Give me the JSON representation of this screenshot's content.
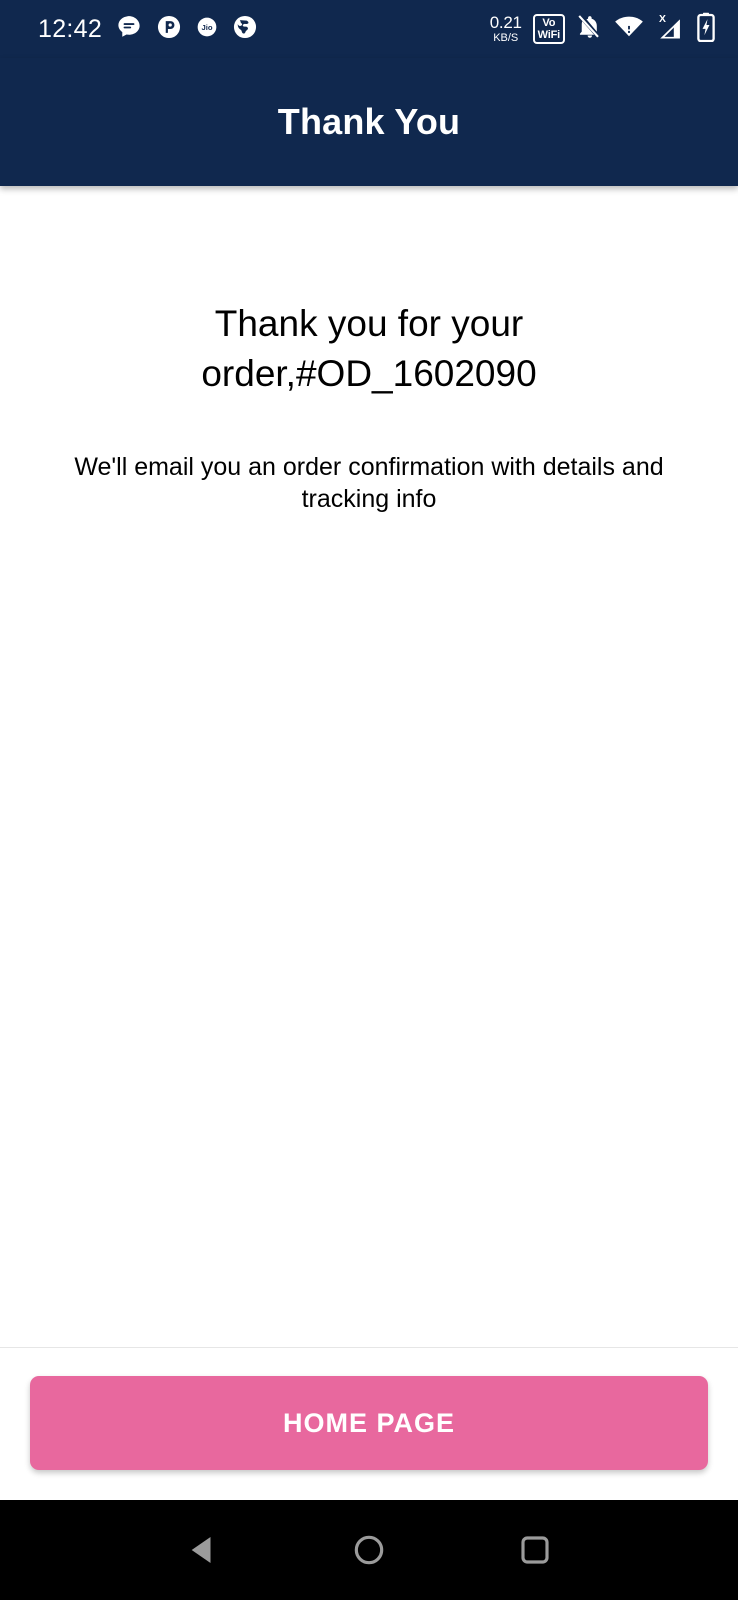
{
  "status_bar": {
    "clock": "12:42",
    "notification_icons": [
      {
        "name": "messages-icon",
        "label": "Messages"
      },
      {
        "name": "app-circle-icon",
        "label": "App"
      },
      {
        "name": "jio-icon",
        "label": "Jio"
      },
      {
        "name": "globe-icon",
        "label": "Browser"
      }
    ],
    "network_speed_value": "0.21",
    "network_speed_unit": "KB/S",
    "vowifi_line1": "Vo",
    "vowifi_line2": "WiFi",
    "system_icons": [
      {
        "name": "bell-muted-icon",
        "label": "Silent"
      },
      {
        "name": "wifi-icon",
        "label": "WiFi"
      },
      {
        "name": "signal-no-service-icon",
        "label": "No Service"
      },
      {
        "name": "battery-charging-icon",
        "label": "Charging"
      }
    ],
    "background_color": "#10284E",
    "foreground_color": "#FFFFFF"
  },
  "app_bar": {
    "title": "Thank You",
    "background_color": "#10284E",
    "title_color": "#FFFFFF"
  },
  "main": {
    "heading": "Thank you for your order,#OD_1602090",
    "subtext": "We'll email you an order confirmation with details and tracking info",
    "order_id": "#OD_1602090",
    "background_color": "#FFFFFF",
    "text_color": "#000000"
  },
  "footer": {
    "home_button_label": "HOME PAGE",
    "button_color": "#E8689E",
    "button_text_color": "#FFFFFF"
  },
  "nav_bar": {
    "background_color": "#000000",
    "buttons": [
      {
        "name": "nav-back-button",
        "label": "Back"
      },
      {
        "name": "nav-home-button",
        "label": "Home"
      },
      {
        "name": "nav-recents-button",
        "label": "Recents"
      }
    ]
  }
}
